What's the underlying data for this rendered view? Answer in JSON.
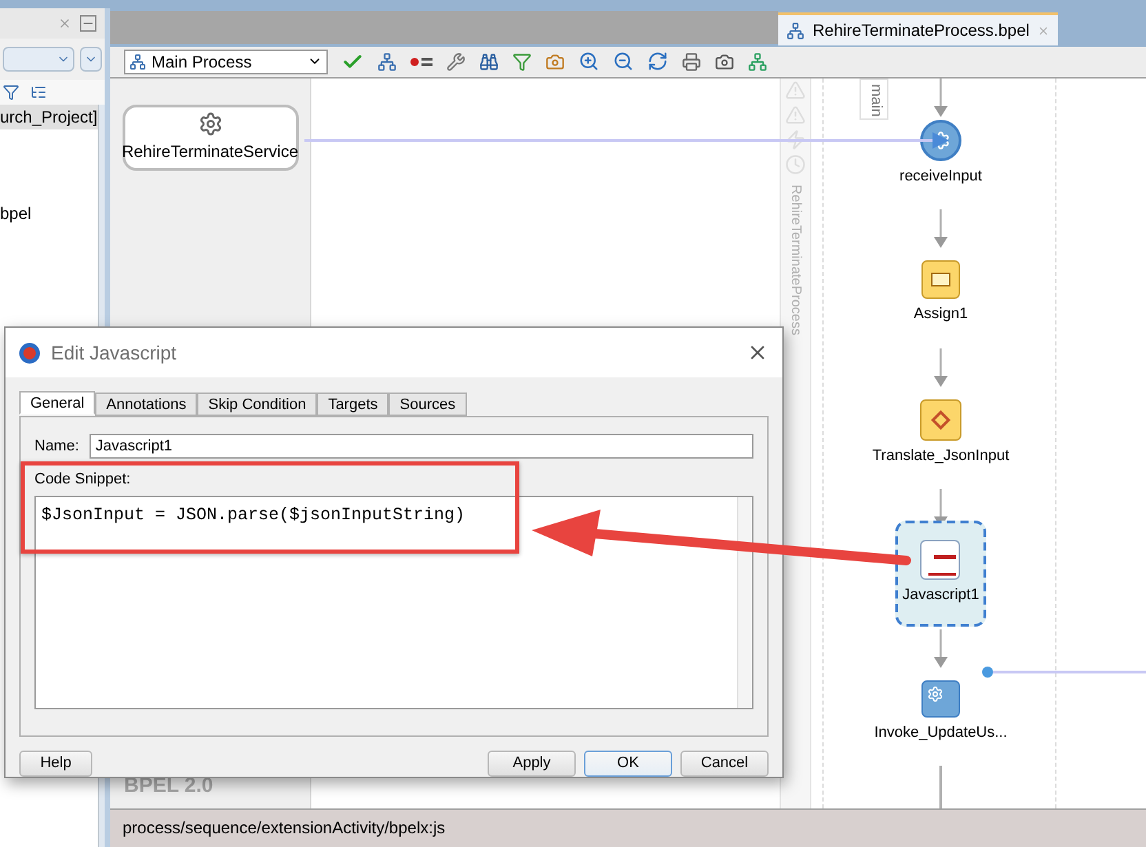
{
  "editor_tab": {
    "title": "RehireTerminateProcess.bpel",
    "selected": true
  },
  "left_panel": {
    "tree_items": [
      "urch_Project]",
      "bpel"
    ]
  },
  "toolbar": {
    "process_selector": "Main Process"
  },
  "partner_link": {
    "name": "RehireTerminateService"
  },
  "swimlane": {
    "title": "RehireTerminateProcess",
    "scope": "main"
  },
  "activities": [
    {
      "name": "receiveInput",
      "kind": "receive",
      "selected": false
    },
    {
      "name": "Assign1",
      "kind": "assign",
      "selected": false
    },
    {
      "name": "Translate_JsonInput",
      "kind": "translate",
      "selected": false
    },
    {
      "name": "Javascript1",
      "kind": "javascript",
      "selected": true
    },
    {
      "name": "Invoke_UpdateUs...",
      "kind": "invoke",
      "selected": false
    }
  ],
  "version_label": "BPEL 2.0",
  "status_bar": "process/sequence/extensionActivity/bpelx:js",
  "dialog": {
    "title": "Edit Javascript",
    "tabs": [
      {
        "label": "General",
        "selected": true
      },
      {
        "label": "Annotations",
        "selected": false
      },
      {
        "label": "Skip Condition",
        "selected": false
      },
      {
        "label": "Targets",
        "selected": false
      },
      {
        "label": "Sources",
        "selected": false
      }
    ],
    "name_label": "Name:",
    "name_value": "Javascript1",
    "code_label": "Code Snippet:",
    "code": "$JsonInput = JSON.parse($jsonInputString)",
    "buttons": [
      {
        "label": "Help",
        "default": false
      },
      {
        "label": "Apply",
        "default": false
      },
      {
        "label": "OK",
        "default": true
      },
      {
        "label": "Cancel",
        "default": false
      }
    ]
  }
}
